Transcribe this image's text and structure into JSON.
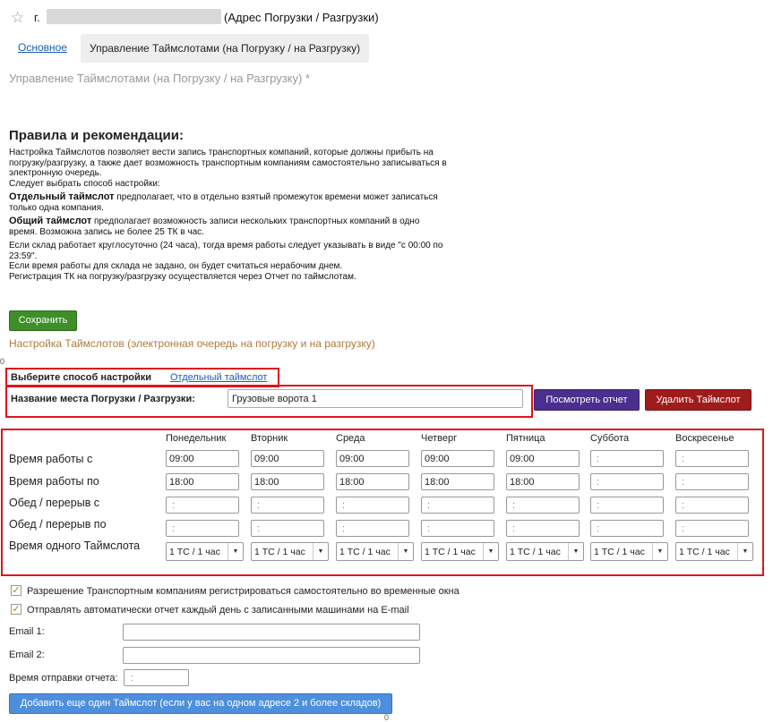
{
  "header": {
    "star_glyph": "☆",
    "address_prefix": "г.",
    "address_suffix": "(Адрес Погрузки / Разгрузки)"
  },
  "tabs": {
    "main": "Основное",
    "active": "Управление Таймслотами (на Погрузку / на Разгрузку)"
  },
  "form_title": "Управление Таймслотами (на Погрузку / на Разгрузку) *",
  "rules": {
    "heading": "Правила и рекомендации:",
    "intro": "Настройка Таймслотов позволяет вести запись транспортных компаний, которые должны прибыть на погрузку/разгрузку, а также дает возможность транспортным компаниям самостоятельно записываться в электронную очередь.",
    "choose": "Следует выбрать способ настройки:",
    "single_term": "Отдельный таймслот",
    "single_text": " предполагает, что в отдельно взятый промежуток времени может записаться только одна компания.",
    "shared_term": "Общий таймслот",
    "shared_text": " предполагает возможность записи нескольких транспортных компаний в одно время. Возможна запись не более 25 ТК в час.",
    "note1": "Если склад работает круглосуточно (24 часа), тогда время работы следует указывать в виде \"с 00:00 по 23:59\".",
    "note2": "Если время работы для склада не задано, он будет считаться нерабочим днем.",
    "note3": "Регистрация ТК на погрузку/разгрузку осуществляется через Отчет по таймслотам."
  },
  "save_button": "Сохранить",
  "section_title": "Настройка Таймслотов (электронная очередь на погрузку и на разгрузку)",
  "method": {
    "label": "Выберите способ настройки",
    "value": "Отдельный таймслот"
  },
  "place": {
    "label": "Название места Погрузки / Разгрузки:",
    "value": "Грузовые ворота 1"
  },
  "buttons": {
    "report": "Посмотреть отчет",
    "delete": "Удалить Таймслот",
    "add": "Добавить еще один Таймслот (если у вас на одном адресе 2 и более складов)"
  },
  "schedule": {
    "days": [
      "Понедельник",
      "Вторник",
      "Среда",
      "Четверг",
      "Пятница",
      "Суббота",
      "Воскресенье"
    ],
    "row_labels": [
      "Время работы с",
      "Время работы по",
      "Обед / перерыв с",
      "Обед / перерыв по",
      "Время одного Таймслота"
    ],
    "work_from": [
      "09:00",
      "09:00",
      "09:00",
      "09:00",
      "09:00",
      " :",
      " :"
    ],
    "work_to": [
      "18:00",
      "18:00",
      "18:00",
      "18:00",
      "18:00",
      " :",
      " :"
    ],
    "lunch_from": [
      " :",
      " :",
      " :",
      " :",
      " :",
      " :",
      " :"
    ],
    "lunch_to": [
      " :",
      " :",
      " :",
      " :",
      " :",
      " :",
      " :"
    ],
    "slot": [
      "1 ТС / 1 час",
      "1 ТС / 1 час",
      "1 ТС / 1 час",
      "1 ТС / 1 час",
      "1 ТС / 1 час",
      "1 ТС / 1 час",
      "1 ТС / 1 час"
    ],
    "dropdown_arrow": "▼"
  },
  "checkboxes": {
    "mark": "✓",
    "self_register": "Разрешение Транспортным компаниям регистрироваться самостоятельно во временные окна",
    "auto_report": "Отправлять автоматически отчет каждый день с записанными машинами на E-mail"
  },
  "emails": {
    "email1_label": "Email 1:",
    "email2_label": "Email 2:",
    "send_time_label": "Время отправки отчета:",
    "send_time_value": " :"
  },
  "markers": {
    "left": "0",
    "bottom": "0"
  }
}
